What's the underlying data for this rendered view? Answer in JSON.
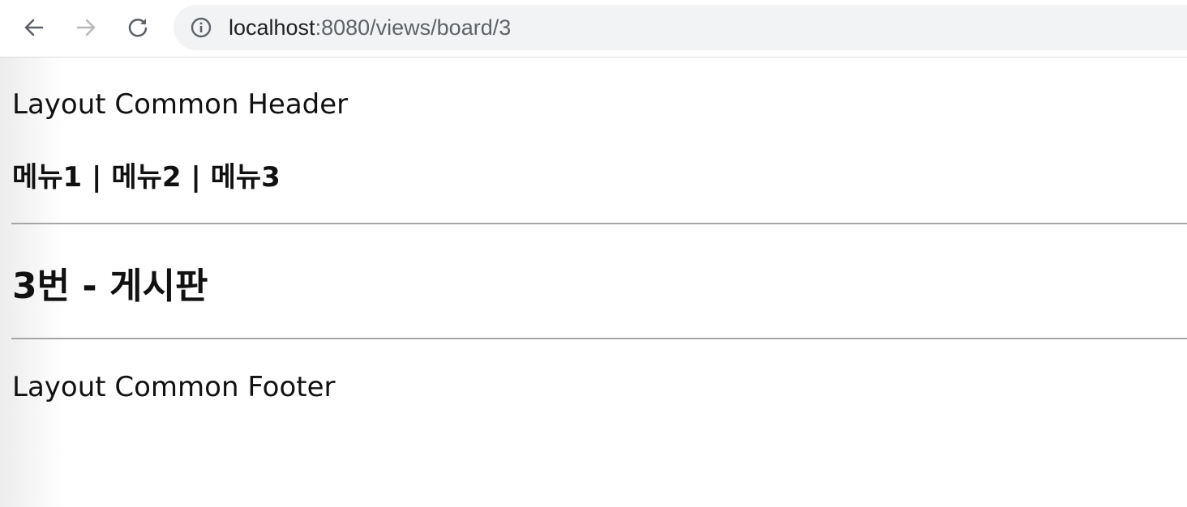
{
  "browser": {
    "url_host": "localhost",
    "url_path": ":8080/views/board/3",
    "icons": {
      "back": "back-arrow-icon",
      "forward": "forward-arrow-icon",
      "reload": "reload-icon",
      "site_info": "info-icon"
    }
  },
  "page": {
    "header_title": "Layout Common Header",
    "menu": {
      "item1": "메뉴1",
      "item2": "메뉴2",
      "item3": "메뉴3",
      "separator": " | "
    },
    "content_title": "3번 - 게시판",
    "footer_title": "Layout Common Footer"
  },
  "colors": {
    "toolbar_bg": "#ffffff",
    "omnibox_bg": "#f1f3f4",
    "divider": "#a6a6a6",
    "text": "#111111",
    "url_path": "#5f6368"
  }
}
